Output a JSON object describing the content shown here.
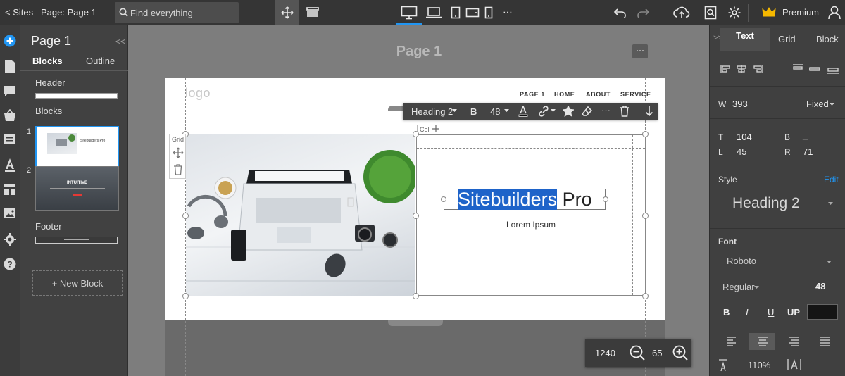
{
  "topbar": {
    "back_label": "< Sites",
    "page_label": "Page: Page 1",
    "search_placeholder": "Find everything",
    "more_label": "⋯",
    "premium_label": "Premium"
  },
  "left_panel": {
    "title": "Page 1",
    "collapse": "<<",
    "tabs": [
      {
        "label": "Blocks"
      },
      {
        "label": "Outline"
      }
    ],
    "header_label": "Header",
    "blocks_label": "Blocks",
    "block_numbers": [
      "1",
      "2"
    ],
    "thumb1_text": "Sitebuilders Pro",
    "thumb2_text": "INTUITIVE",
    "footer_label": "Footer",
    "new_block_label": "+ New Block"
  },
  "canvas": {
    "title": "Page 1",
    "more": "···",
    "logo": "logo",
    "nav": [
      "PAGE 1",
      "HOME",
      "ABOUT",
      "SERVICE"
    ],
    "cell_label": "Cell",
    "grid_label": "Grid",
    "heading_selected": "Sitebuilders",
    "heading_rest": " Pro",
    "body_text": "Lorem Ipsum"
  },
  "text_toolbar": {
    "style": "Heading 2",
    "size": "48",
    "more": "···"
  },
  "zoom": {
    "width": "1240",
    "level": "65"
  },
  "right_panel": {
    "collapse": ">>",
    "tabs": [
      {
        "label": "Text"
      },
      {
        "label": "Grid"
      },
      {
        "label": "Block"
      }
    ],
    "width_label": "W",
    "width_value": "393",
    "width_mode": "Fixed",
    "t_label": "T",
    "t_value": "104",
    "b_label": "B",
    "b_value": "_",
    "l_label": "L",
    "l_value": "45",
    "r_label": "R",
    "r_value": "71",
    "style_label": "Style",
    "edit_label": "Edit",
    "style_value": "Heading 2",
    "font_label": "Font",
    "font_value": "Roboto",
    "weight_value": "Regular",
    "font_size": "48",
    "fmt": [
      "B",
      "I",
      "U",
      "UP"
    ],
    "line_height": "110%",
    "text_color": "#151515"
  },
  "colors": {
    "accent": "#2196f3",
    "selection": "#1e63c9",
    "premium_crown": "#f5b800"
  }
}
